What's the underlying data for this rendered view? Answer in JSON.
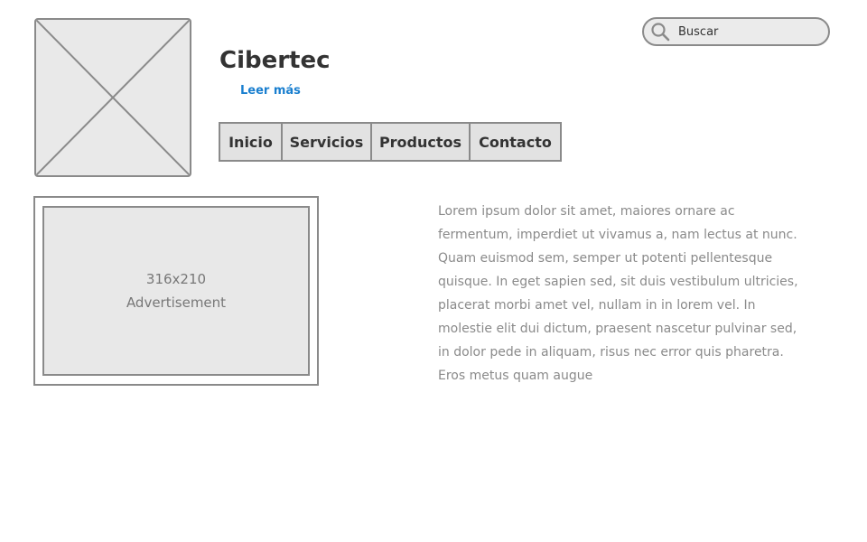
{
  "header": {
    "site_title": "Cibertec",
    "read_more": "Leer más"
  },
  "search": {
    "placeholder": "Buscar",
    "icon": "search-icon"
  },
  "nav": {
    "items": [
      {
        "label": "Inicio"
      },
      {
        "label": "Servicios"
      },
      {
        "label": "Productos"
      },
      {
        "label": "Contacto"
      }
    ]
  },
  "ad": {
    "size": "316x210",
    "label": "Advertisement"
  },
  "content": {
    "paragraph": "Lorem ipsum dolor sit amet, maiores ornare ac fermentum, imperdiet ut vivamus a, nam lectus at nunc. Quam euismod sem, semper ut potenti pellentesque quisque. In eget sapien sed, sit duis vestibulum ultricies, placerat morbi amet vel, nullam in in lorem vel. In molestie elit dui dictum, praesent nascetur pulvinar sed, in dolor pede in aliquam, risus nec error quis pharetra. Eros metus quam augue"
  },
  "colors": {
    "link": "#1a7fcf",
    "border": "#8a8a8a",
    "placeholder_fill": "#e9e9e9",
    "text": "#333333",
    "muted_text": "#8a8a8a"
  }
}
